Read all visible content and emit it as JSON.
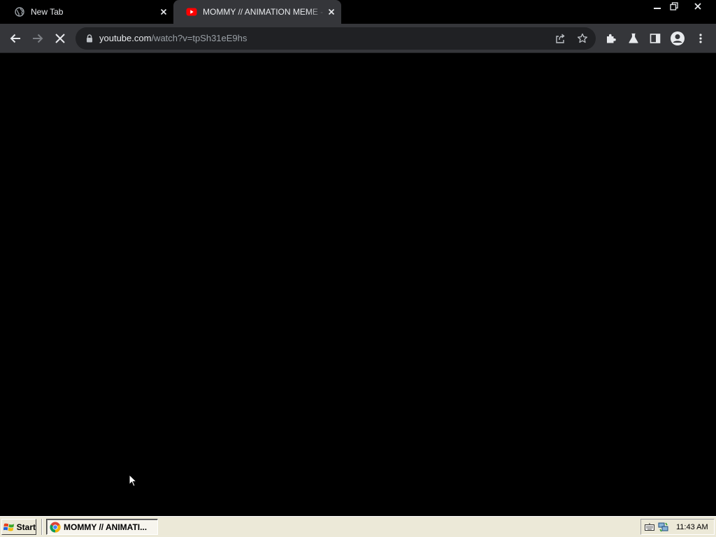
{
  "browser": {
    "tabs": [
      {
        "title": "New Tab",
        "icon": "globe-icon",
        "active": false
      },
      {
        "title": "MOMMY // ANIMATION MEME - YouTube",
        "icon": "youtube-icon",
        "active": true
      }
    ],
    "address_bar": {
      "domain": "youtube.com",
      "path": "/watch?v=tpSh31eE9hs"
    },
    "loading": true
  },
  "taskbar": {
    "start_label": "Start",
    "tasks": [
      {
        "label": "MOMMY // ANIMATI..."
      }
    ],
    "clock": "11:43 AM"
  },
  "colors": {
    "content_bg": "#000000",
    "toolbar_bg": "#35363a",
    "omnibox_bg": "#202124",
    "taskbar_bg": "#ece9d8",
    "youtube_red": "#ff0000"
  }
}
